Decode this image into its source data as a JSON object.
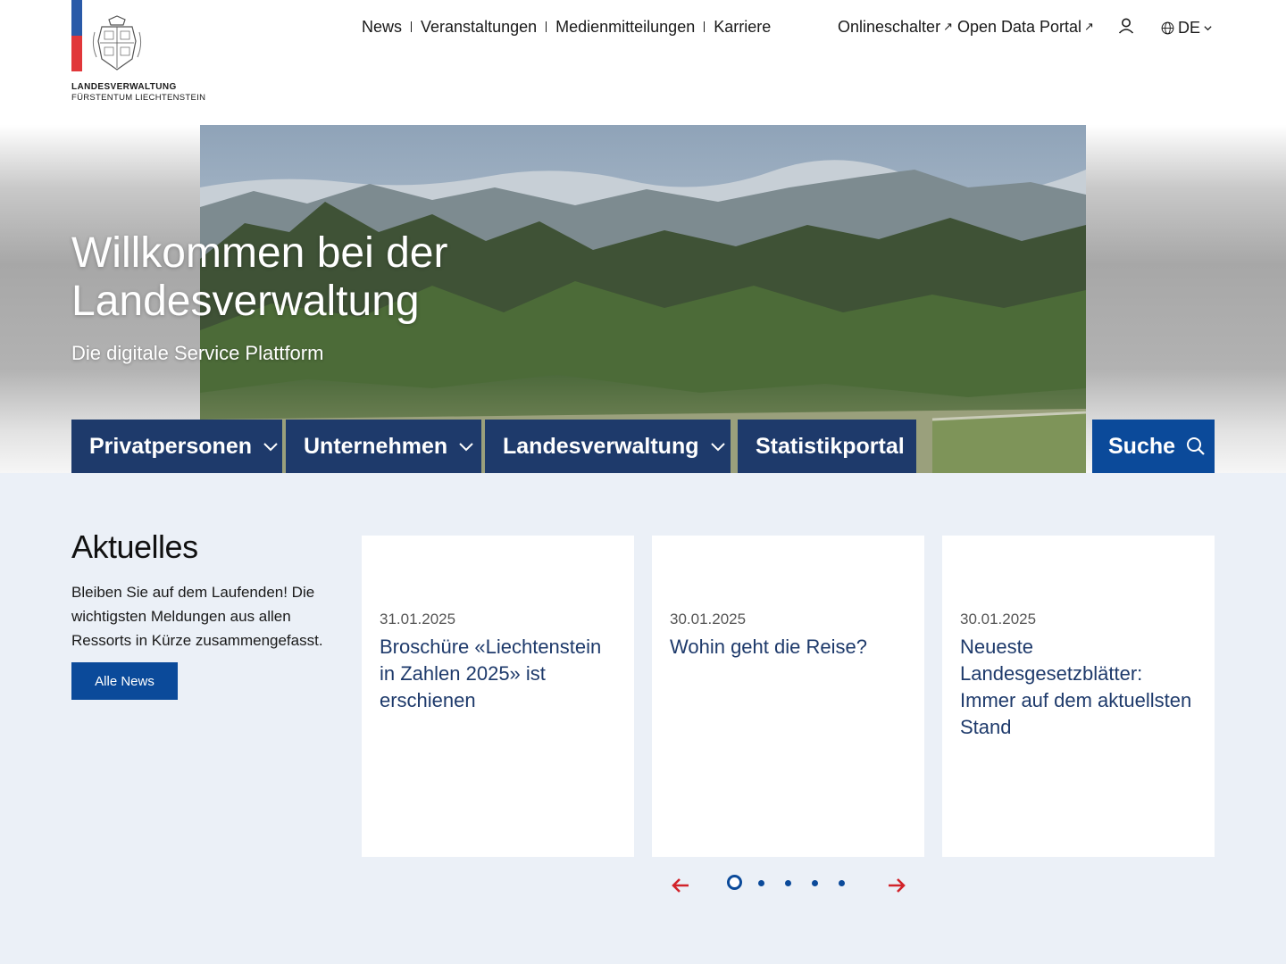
{
  "header": {
    "logo": {
      "line1": "LANDESVERWALTUNG",
      "line2": "FÜRSTENTUM LIECHTENSTEIN",
      "colors": {
        "blue": "#2a5aa8",
        "red": "#e1373a"
      }
    },
    "topnav": [
      {
        "label": "News"
      },
      {
        "label": "Veranstaltungen"
      },
      {
        "label": "Medienmitteilungen"
      },
      {
        "label": "Karriere"
      }
    ],
    "external_links": [
      {
        "label": "Onlineschalter",
        "icon": "external-arrow-icon"
      },
      {
        "label": "Open Data Portal",
        "icon": "external-arrow-icon"
      }
    ],
    "user_icon": "user-icon",
    "language": {
      "current": "DE",
      "icon": "globe-icon"
    }
  },
  "hero": {
    "title_line1": "Willkommen bei der",
    "title_line2": "Landesverwaltung",
    "subtitle": "Die digitale Service Plattform"
  },
  "mainnav": {
    "items": [
      {
        "label": "Privatpersonen",
        "has_dropdown": true
      },
      {
        "label": "Unternehmen",
        "has_dropdown": true
      },
      {
        "label": "Landesverwaltung",
        "has_dropdown": true
      },
      {
        "label": "Statistikportal",
        "has_dropdown": false
      }
    ],
    "search": {
      "label": "Suche",
      "icon": "search-icon"
    },
    "colors": {
      "nav": "#1e3a6b",
      "search": "#0b4a9a"
    }
  },
  "news": {
    "heading": "Aktuelles",
    "intro": "Bleiben Sie auf dem Laufenden! Die wichtigsten Meldungen aus allen Ressorts in Kürze zusammengefasst.",
    "all_button": "Alle News",
    "cards": [
      {
        "date": "31.01.2025",
        "title": "Broschüre «Liechtenstein in Zahlen 2025» ist erschienen"
      },
      {
        "date": "30.01.2025",
        "title": "Wohin geht die Reise?"
      },
      {
        "date": "30.01.2025",
        "title": "Neueste Landesgesetzblätter: Immer auf dem aktuellsten Stand"
      }
    ],
    "pagination": {
      "pages": 5,
      "current": 1
    },
    "arrow_color": "#d2232a"
  }
}
